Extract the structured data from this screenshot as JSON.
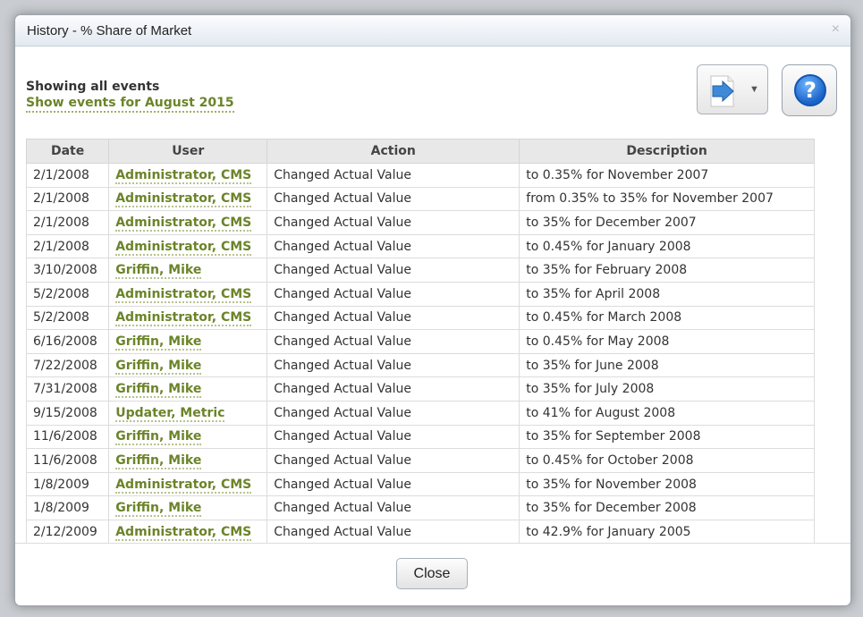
{
  "dialog": {
    "title": "History - % Share of Market",
    "close_glyph": "×",
    "subheading": "Showing all events",
    "filter_link": "Show events for August 2015",
    "help_glyph": "?",
    "close_button_label": "Close"
  },
  "table": {
    "headers": [
      "Date",
      "User",
      "Action",
      "Description"
    ],
    "rows": [
      {
        "date": "2/1/2008",
        "user": "Administrator, CMS",
        "action": "Changed Actual Value",
        "description": "to 0.35% for November 2007"
      },
      {
        "date": "2/1/2008",
        "user": "Administrator, CMS",
        "action": "Changed Actual Value",
        "description": "from 0.35% to 35% for November 2007"
      },
      {
        "date": "2/1/2008",
        "user": "Administrator, CMS",
        "action": "Changed Actual Value",
        "description": "to 35% for December 2007"
      },
      {
        "date": "2/1/2008",
        "user": "Administrator, CMS",
        "action": "Changed Actual Value",
        "description": "to 0.45% for January 2008"
      },
      {
        "date": "3/10/2008",
        "user": "Griffin, Mike",
        "action": "Changed Actual Value",
        "description": "to 35% for February 2008"
      },
      {
        "date": "5/2/2008",
        "user": "Administrator, CMS",
        "action": "Changed Actual Value",
        "description": "to 35% for April 2008"
      },
      {
        "date": "5/2/2008",
        "user": "Administrator, CMS",
        "action": "Changed Actual Value",
        "description": "to 0.45% for March 2008"
      },
      {
        "date": "6/16/2008",
        "user": "Griffin, Mike",
        "action": "Changed Actual Value",
        "description": "to 0.45% for May 2008"
      },
      {
        "date": "7/22/2008",
        "user": "Griffin, Mike",
        "action": "Changed Actual Value",
        "description": "to 35% for June 2008"
      },
      {
        "date": "7/31/2008",
        "user": "Griffin, Mike",
        "action": "Changed Actual Value",
        "description": "to 35% for July 2008"
      },
      {
        "date": "9/15/2008",
        "user": "Updater, Metric",
        "action": "Changed Actual Value",
        "description": "to 41% for August 2008"
      },
      {
        "date": "11/6/2008",
        "user": "Griffin, Mike",
        "action": "Changed Actual Value",
        "description": "to 35% for September 2008"
      },
      {
        "date": "11/6/2008",
        "user": "Griffin, Mike",
        "action": "Changed Actual Value",
        "description": "to 0.45% for October 2008"
      },
      {
        "date": "1/8/2009",
        "user": "Administrator, CMS",
        "action": "Changed Actual Value",
        "description": "to 35% for November 2008"
      },
      {
        "date": "1/8/2009",
        "user": "Griffin, Mike",
        "action": "Changed Actual Value",
        "description": "to 35% for December 2008"
      },
      {
        "date": "2/12/2009",
        "user": "Administrator, CMS",
        "action": "Changed Actual Value",
        "description": "to 42.9% for January 2005"
      }
    ]
  },
  "icons": {
    "export": "export-menu-icon",
    "help": "help-icon",
    "close": "close-icon"
  },
  "colors": {
    "link_green": "#6b8429",
    "help_blue": "#1a63c8"
  }
}
